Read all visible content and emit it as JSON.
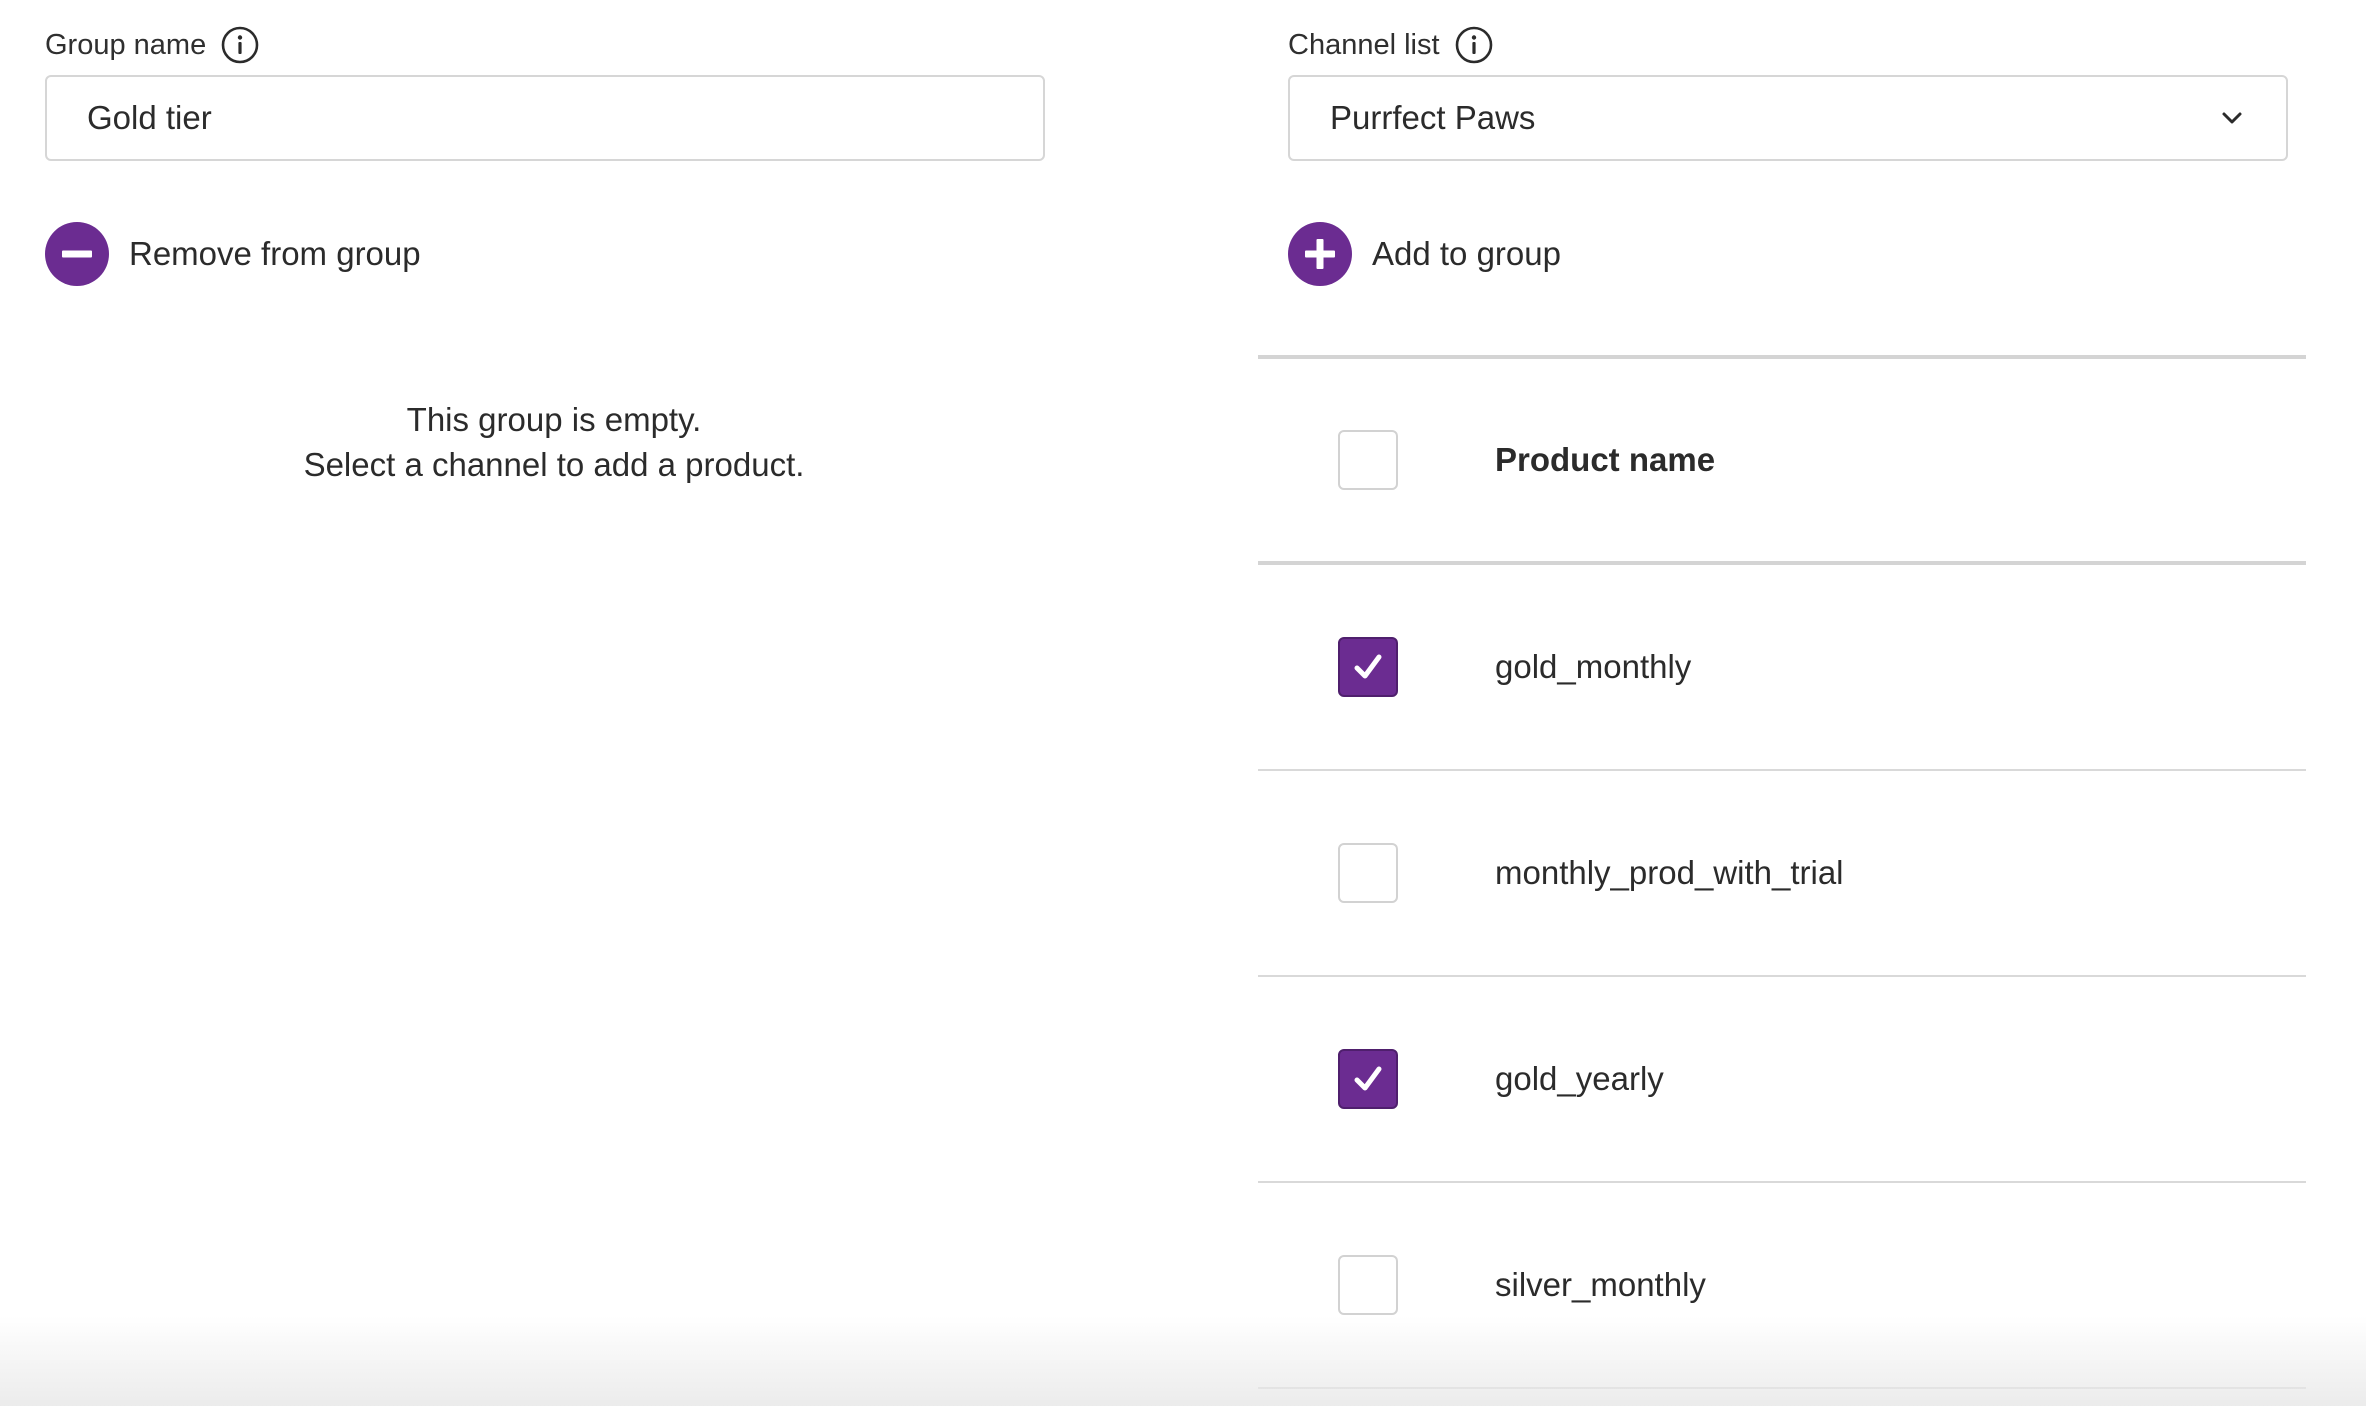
{
  "left": {
    "group_name_label": "Group name",
    "group_name_value": "Gold tier",
    "remove_label": "Remove from group",
    "empty_line1": "This group is empty.",
    "empty_line2": "Select a channel to add a product."
  },
  "right": {
    "channel_list_label": "Channel list",
    "channel_selected": "Purrfect Paws",
    "add_label": "Add to group",
    "table": {
      "header": "Product name",
      "header_checked": false,
      "rows": [
        {
          "name": "gold_monthly",
          "checked": true
        },
        {
          "name": "monthly_prod_with_trial",
          "checked": false
        },
        {
          "name": "gold_yearly",
          "checked": true
        },
        {
          "name": "silver_monthly",
          "checked": false
        }
      ]
    }
  },
  "colors": {
    "accent": "#6b2c91"
  },
  "icons": {
    "info": "info-icon",
    "remove": "minus-circle-icon",
    "add": "plus-circle-icon",
    "dropdown": "chevron-down-icon",
    "check": "checkmark-icon"
  }
}
